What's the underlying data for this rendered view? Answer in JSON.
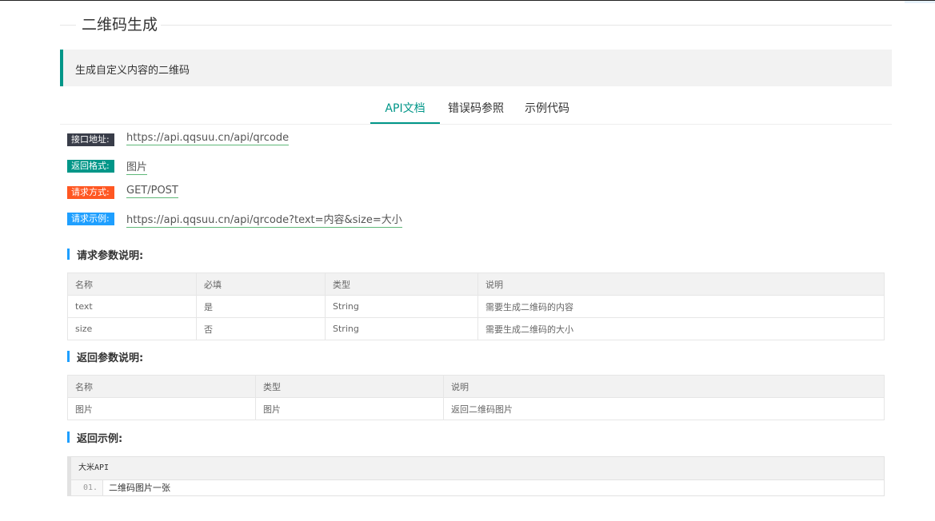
{
  "page": {
    "title": "二维码生成"
  },
  "quote": {
    "text": "生成自定义内容的二维码"
  },
  "tabs": [
    {
      "label": "API文档",
      "active": true
    },
    {
      "label": "错误码参照",
      "active": false
    },
    {
      "label": "示例代码",
      "active": false
    }
  ],
  "info": {
    "endpoint": {
      "label": "接口地址:",
      "value": "https://api.qqsuu.cn/api/qrcode"
    },
    "format": {
      "label": "返回格式:",
      "value": "图片"
    },
    "method": {
      "label": "请求方式:",
      "value": "GET/POST"
    },
    "example": {
      "label": "请求示例:",
      "value": "https://api.qqsuu.cn/api/qrcode?text=内容&size=大小"
    }
  },
  "request_params": {
    "heading": "请求参数说明:",
    "headers": [
      "名称",
      "必填",
      "类型",
      "说明"
    ],
    "rows": [
      [
        "text",
        "是",
        "String",
        "需要生成二维码的内容"
      ],
      [
        "size",
        "否",
        "String",
        "需要生成二维码的大小"
      ]
    ]
  },
  "response_params": {
    "heading": "返回参数说明:",
    "headers": [
      "名称",
      "类型",
      "说明"
    ],
    "rows": [
      [
        "图片",
        "图片",
        "返回二维码图片"
      ]
    ]
  },
  "response_example": {
    "heading": "返回示例:",
    "code_title": "大米API",
    "lines": [
      {
        "num": "01.",
        "text": "二维码图片一张"
      }
    ]
  },
  "colors": {
    "accent": "#009688",
    "badge_endpoint": "#393d49",
    "badge_format": "#009688",
    "badge_method": "#ff5722",
    "badge_example": "#1e9fff",
    "section_bar": "#1e9fff"
  }
}
